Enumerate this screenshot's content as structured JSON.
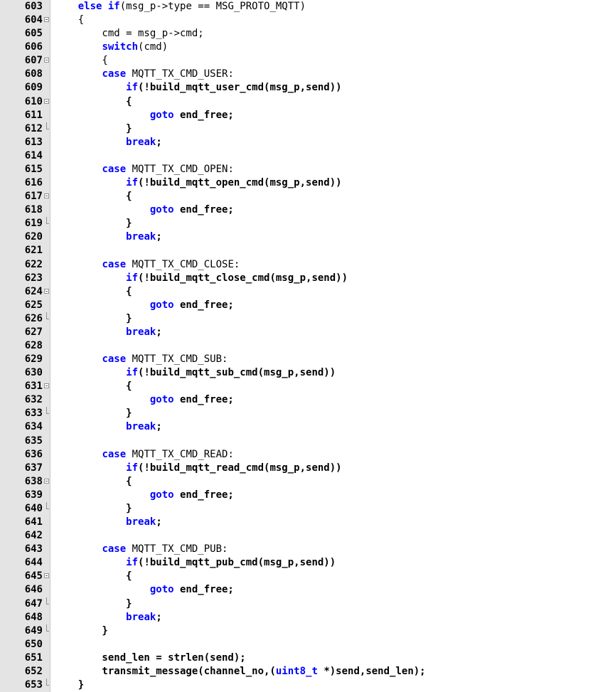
{
  "editor": {
    "lines": [
      {
        "n": "603",
        "fold": "",
        "tokens": [
          {
            "t": "    ",
            "c": "pl"
          },
          {
            "t": "else if",
            "c": "kw"
          },
          {
            "t": "(msg_p->type == MSG_PROTO_MQTT)",
            "c": "pl"
          }
        ]
      },
      {
        "n": "604",
        "fold": "open",
        "tokens": [
          {
            "t": "    {",
            "c": "pl"
          }
        ]
      },
      {
        "n": "605",
        "fold": "",
        "tokens": [
          {
            "t": "        cmd = msg_p->cmd;",
            "c": "pl"
          }
        ]
      },
      {
        "n": "606",
        "fold": "",
        "tokens": [
          {
            "t": "        ",
            "c": "pl"
          },
          {
            "t": "switch",
            "c": "kw"
          },
          {
            "t": "(cmd)",
            "c": "pl"
          }
        ]
      },
      {
        "n": "607",
        "fold": "open",
        "tokens": [
          {
            "t": "        {",
            "c": "pl"
          }
        ]
      },
      {
        "n": "608",
        "fold": "",
        "tokens": [
          {
            "t": "        ",
            "c": "pl"
          },
          {
            "t": "case",
            "c": "kw"
          },
          {
            "t": " MQTT_TX_CMD_USER:",
            "c": "pl"
          }
        ]
      },
      {
        "n": "609",
        "fold": "",
        "tokens": [
          {
            "t": "            ",
            "c": "pl"
          },
          {
            "t": "if",
            "c": "kw"
          },
          {
            "t": "(!build_mqtt_user_cmd(msg_p,send))",
            "c": "tx"
          }
        ]
      },
      {
        "n": "610",
        "fold": "open",
        "tokens": [
          {
            "t": "            {",
            "c": "tx"
          }
        ]
      },
      {
        "n": "611",
        "fold": "",
        "tokens": [
          {
            "t": "                ",
            "c": "pl"
          },
          {
            "t": "goto",
            "c": "kw"
          },
          {
            "t": " end_free;",
            "c": "tx"
          }
        ]
      },
      {
        "n": "612",
        "fold": "end",
        "tokens": [
          {
            "t": "            }",
            "c": "tx"
          }
        ]
      },
      {
        "n": "613",
        "fold": "",
        "tokens": [
          {
            "t": "            ",
            "c": "pl"
          },
          {
            "t": "break",
            "c": "kw"
          },
          {
            "t": ";",
            "c": "tx"
          }
        ]
      },
      {
        "n": "614",
        "fold": "",
        "tokens": []
      },
      {
        "n": "615",
        "fold": "",
        "tokens": [
          {
            "t": "        ",
            "c": "pl"
          },
          {
            "t": "case",
            "c": "kw"
          },
          {
            "t": " MQTT_TX_CMD_OPEN:",
            "c": "pl"
          }
        ]
      },
      {
        "n": "616",
        "fold": "",
        "tokens": [
          {
            "t": "            ",
            "c": "pl"
          },
          {
            "t": "if",
            "c": "kw"
          },
          {
            "t": "(!build_mqtt_open_cmd(msg_p,send))",
            "c": "tx"
          }
        ]
      },
      {
        "n": "617",
        "fold": "open",
        "tokens": [
          {
            "t": "            {",
            "c": "tx"
          }
        ]
      },
      {
        "n": "618",
        "fold": "",
        "tokens": [
          {
            "t": "                ",
            "c": "pl"
          },
          {
            "t": "goto",
            "c": "kw"
          },
          {
            "t": " end_free;",
            "c": "tx"
          }
        ]
      },
      {
        "n": "619",
        "fold": "end",
        "tokens": [
          {
            "t": "            }",
            "c": "tx"
          }
        ]
      },
      {
        "n": "620",
        "fold": "",
        "tokens": [
          {
            "t": "            ",
            "c": "pl"
          },
          {
            "t": "break",
            "c": "kw"
          },
          {
            "t": ";",
            "c": "tx"
          }
        ]
      },
      {
        "n": "621",
        "fold": "",
        "tokens": []
      },
      {
        "n": "622",
        "fold": "",
        "tokens": [
          {
            "t": "        ",
            "c": "pl"
          },
          {
            "t": "case",
            "c": "kw"
          },
          {
            "t": " MQTT_TX_CMD_CLOSE:",
            "c": "pl"
          }
        ]
      },
      {
        "n": "623",
        "fold": "",
        "tokens": [
          {
            "t": "            ",
            "c": "pl"
          },
          {
            "t": "if",
            "c": "kw"
          },
          {
            "t": "(!build_mqtt_close_cmd(msg_p,send))",
            "c": "tx"
          }
        ]
      },
      {
        "n": "624",
        "fold": "open",
        "tokens": [
          {
            "t": "            {",
            "c": "tx"
          }
        ]
      },
      {
        "n": "625",
        "fold": "",
        "tokens": [
          {
            "t": "                ",
            "c": "pl"
          },
          {
            "t": "goto",
            "c": "kw"
          },
          {
            "t": " end_free;",
            "c": "tx"
          }
        ]
      },
      {
        "n": "626",
        "fold": "end",
        "tokens": [
          {
            "t": "            }",
            "c": "tx"
          }
        ]
      },
      {
        "n": "627",
        "fold": "",
        "tokens": [
          {
            "t": "            ",
            "c": "pl"
          },
          {
            "t": "break",
            "c": "kw"
          },
          {
            "t": ";",
            "c": "tx"
          }
        ]
      },
      {
        "n": "628",
        "fold": "",
        "tokens": []
      },
      {
        "n": "629",
        "fold": "",
        "tokens": [
          {
            "t": "        ",
            "c": "pl"
          },
          {
            "t": "case",
            "c": "kw"
          },
          {
            "t": " MQTT_TX_CMD_SUB:",
            "c": "pl"
          }
        ]
      },
      {
        "n": "630",
        "fold": "",
        "tokens": [
          {
            "t": "            ",
            "c": "pl"
          },
          {
            "t": "if",
            "c": "kw"
          },
          {
            "t": "(!build_mqtt_sub_cmd(msg_p,send))",
            "c": "tx"
          }
        ]
      },
      {
        "n": "631",
        "fold": "open",
        "tokens": [
          {
            "t": "            {",
            "c": "tx"
          }
        ]
      },
      {
        "n": "632",
        "fold": "",
        "tokens": [
          {
            "t": "                ",
            "c": "pl"
          },
          {
            "t": "goto",
            "c": "kw"
          },
          {
            "t": " end_free;",
            "c": "tx"
          }
        ]
      },
      {
        "n": "633",
        "fold": "end",
        "tokens": [
          {
            "t": "            }",
            "c": "tx"
          }
        ]
      },
      {
        "n": "634",
        "fold": "",
        "tokens": [
          {
            "t": "            ",
            "c": "pl"
          },
          {
            "t": "break",
            "c": "kw"
          },
          {
            "t": ";",
            "c": "tx"
          }
        ]
      },
      {
        "n": "635",
        "fold": "",
        "tokens": []
      },
      {
        "n": "636",
        "fold": "",
        "tokens": [
          {
            "t": "        ",
            "c": "pl"
          },
          {
            "t": "case",
            "c": "kw"
          },
          {
            "t": " MQTT_TX_CMD_READ:",
            "c": "pl"
          }
        ]
      },
      {
        "n": "637",
        "fold": "",
        "tokens": [
          {
            "t": "            ",
            "c": "pl"
          },
          {
            "t": "if",
            "c": "kw"
          },
          {
            "t": "(!build_mqtt_read_cmd(msg_p,send))",
            "c": "tx"
          }
        ]
      },
      {
        "n": "638",
        "fold": "open",
        "tokens": [
          {
            "t": "            {",
            "c": "tx"
          }
        ]
      },
      {
        "n": "639",
        "fold": "",
        "tokens": [
          {
            "t": "                ",
            "c": "pl"
          },
          {
            "t": "goto",
            "c": "kw"
          },
          {
            "t": " end_free;",
            "c": "tx"
          }
        ]
      },
      {
        "n": "640",
        "fold": "end",
        "tokens": [
          {
            "t": "            }",
            "c": "tx"
          }
        ]
      },
      {
        "n": "641",
        "fold": "",
        "tokens": [
          {
            "t": "            ",
            "c": "pl"
          },
          {
            "t": "break",
            "c": "kw"
          },
          {
            "t": ";",
            "c": "tx"
          }
        ]
      },
      {
        "n": "642",
        "fold": "",
        "tokens": []
      },
      {
        "n": "643",
        "fold": "",
        "tokens": [
          {
            "t": "        ",
            "c": "pl"
          },
          {
            "t": "case",
            "c": "kw"
          },
          {
            "t": " MQTT_TX_CMD_PUB:",
            "c": "pl"
          }
        ]
      },
      {
        "n": "644",
        "fold": "",
        "tokens": [
          {
            "t": "            ",
            "c": "pl"
          },
          {
            "t": "if",
            "c": "kw"
          },
          {
            "t": "(!build_mqtt_pub_cmd(msg_p,send))",
            "c": "tx"
          }
        ]
      },
      {
        "n": "645",
        "fold": "open",
        "tokens": [
          {
            "t": "            {",
            "c": "tx"
          }
        ]
      },
      {
        "n": "646",
        "fold": "",
        "tokens": [
          {
            "t": "                ",
            "c": "pl"
          },
          {
            "t": "goto",
            "c": "kw"
          },
          {
            "t": " end_free;",
            "c": "tx"
          }
        ]
      },
      {
        "n": "647",
        "fold": "end",
        "tokens": [
          {
            "t": "            }",
            "c": "tx"
          }
        ]
      },
      {
        "n": "648",
        "fold": "",
        "tokens": [
          {
            "t": "            ",
            "c": "pl"
          },
          {
            "t": "break",
            "c": "kw"
          },
          {
            "t": ";",
            "c": "tx"
          }
        ]
      },
      {
        "n": "649",
        "fold": "end",
        "tokens": [
          {
            "t": "        }",
            "c": "tx"
          }
        ]
      },
      {
        "n": "650",
        "fold": "",
        "tokens": []
      },
      {
        "n": "651",
        "fold": "",
        "tokens": [
          {
            "t": "        send_len = strlen(send);",
            "c": "tx"
          }
        ]
      },
      {
        "n": "652",
        "fold": "",
        "tokens": [
          {
            "t": "        transmit_message(channel_no,(",
            "c": "tx"
          },
          {
            "t": "uint8_t",
            "c": "kw"
          },
          {
            "t": " *)send,send_len);",
            "c": "tx"
          }
        ]
      },
      {
        "n": "653",
        "fold": "end",
        "tokens": [
          {
            "t": "    }",
            "c": "tx"
          }
        ]
      }
    ]
  }
}
